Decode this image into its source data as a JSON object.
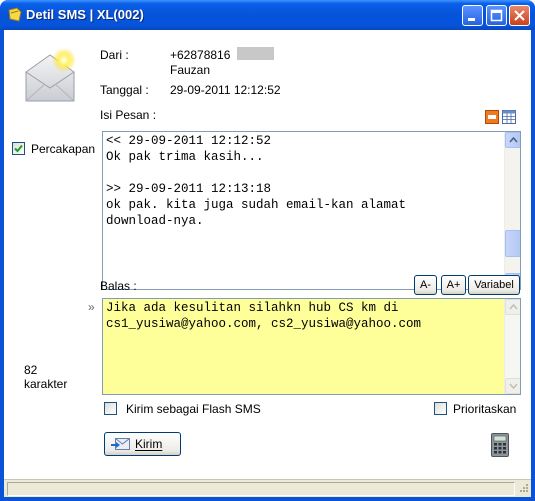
{
  "window": {
    "title": "Detil SMS  |  XL(002)"
  },
  "header": {
    "from_label": "Dari :",
    "from_number": "+62878816",
    "from_name": "Fauzan",
    "date_label": "Tanggal :",
    "date_value": "29-09-2011 12:12:52"
  },
  "message": {
    "label": "Isi Pesan :",
    "conversation_checkbox_label": "Percakapan",
    "conversation_checked": true,
    "lines": [
      "<< 29-09-2011 12:12:52",
      "Ok pak trima kasih...",
      "",
      ">> 29-09-2011 12:13:18",
      "ok pak. kita juga sudah email-kan alamat",
      "download-nya."
    ]
  },
  "reply": {
    "label": "Balas :",
    "font_smaller": "A-",
    "font_larger": "A+",
    "variable_button": "Variabel",
    "arrow": "»",
    "text_lines": [
      "Jika ada kesulitan silahkn hub CS km di",
      "cs1_yusiwa@yahoo.com, cs2_yusiwa@yahoo.com"
    ],
    "char_count": "82",
    "char_label": "karakter",
    "flash_sms_label": "Kirim sebagai Flash SMS",
    "flash_checked": false,
    "priority_label": "Prioritaskan",
    "priority_checked": false,
    "send_button": "Kirim"
  },
  "colors": {
    "reply_background": "#ffff99",
    "titlebar": "#0553d9"
  }
}
